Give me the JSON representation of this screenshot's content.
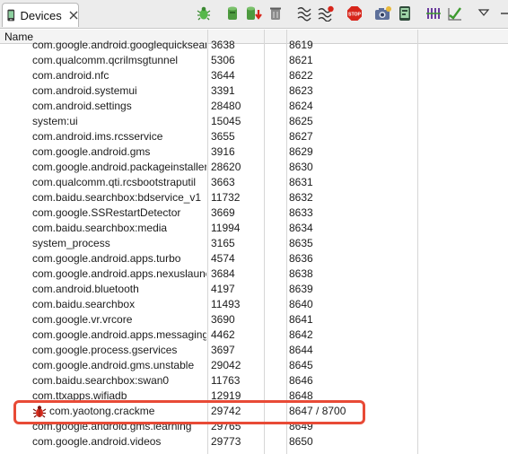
{
  "view": {
    "tab_label": "Devices"
  },
  "toolbar": {
    "buttons": [
      "debug-process-icon",
      "update-heap-icon",
      "dump-hprof-icon",
      "cause-gc-icon",
      "update-threads-icon",
      "start-method-profiling-icon",
      "stop-process-icon",
      "screen-capture-icon",
      "dump-view-hierarchy-icon",
      "systrace-icon",
      "opengl-trace-icon",
      "view-menu-icon",
      "minimize-icon",
      "maximize-icon"
    ]
  },
  "table": {
    "columns": [
      "Name"
    ],
    "rows": [
      {
        "name": "com.google.android.googlequicksearchbox",
        "pid": "3638",
        "port": "8619"
      },
      {
        "name": "com.qualcomm.qcrilmsgtunnel",
        "pid": "5306",
        "port": "8621"
      },
      {
        "name": "com.android.nfc",
        "pid": "3644",
        "port": "8622"
      },
      {
        "name": "com.android.systemui",
        "pid": "3391",
        "port": "8623"
      },
      {
        "name": "com.android.settings",
        "pid": "28480",
        "port": "8624"
      },
      {
        "name": "system:ui",
        "pid": "15045",
        "port": "8625"
      },
      {
        "name": "com.android.ims.rcsservice",
        "pid": "3655",
        "port": "8627"
      },
      {
        "name": "com.google.android.gms",
        "pid": "3916",
        "port": "8629"
      },
      {
        "name": "com.google.android.packageinstaller",
        "pid": "28620",
        "port": "8630"
      },
      {
        "name": "com.qualcomm.qti.rcsbootstraputil",
        "pid": "3663",
        "port": "8631"
      },
      {
        "name": "com.baidu.searchbox:bdservice_v1",
        "pid": "11732",
        "port": "8632"
      },
      {
        "name": "com.google.SSRestartDetector",
        "pid": "3669",
        "port": "8633"
      },
      {
        "name": "com.baidu.searchbox:media",
        "pid": "11994",
        "port": "8634"
      },
      {
        "name": "system_process",
        "pid": "3165",
        "port": "8635"
      },
      {
        "name": "com.google.android.apps.turbo",
        "pid": "4574",
        "port": "8636"
      },
      {
        "name": "com.google.android.apps.nexuslauncher",
        "pid": "3684",
        "port": "8638"
      },
      {
        "name": "com.android.bluetooth",
        "pid": "4197",
        "port": "8639"
      },
      {
        "name": "com.baidu.searchbox",
        "pid": "11493",
        "port": "8640"
      },
      {
        "name": "com.google.vr.vrcore",
        "pid": "3690",
        "port": "8641"
      },
      {
        "name": "com.google.android.apps.messaging",
        "pid": "4462",
        "port": "8642"
      },
      {
        "name": "com.google.process.gservices",
        "pid": "3697",
        "port": "8644"
      },
      {
        "name": "com.google.android.gms.unstable",
        "pid": "29042",
        "port": "8645"
      },
      {
        "name": "com.baidu.searchbox:swan0",
        "pid": "11763",
        "port": "8646"
      },
      {
        "name": "com.ttxapps.wifiadb",
        "pid": "12919",
        "port": "8648"
      },
      {
        "name": "com.yaotong.crackme",
        "pid": "29742",
        "port": "8647 / 8700",
        "debugging": true
      },
      {
        "name": "com.google.android.gms.learning",
        "pid": "29765",
        "port": "8649"
      },
      {
        "name": "com.google.android.videos",
        "pid": "29773",
        "port": "8650"
      }
    ]
  },
  "colors": {
    "highlight_border": "#e84a36",
    "debug_icon": "#d42a1c"
  }
}
